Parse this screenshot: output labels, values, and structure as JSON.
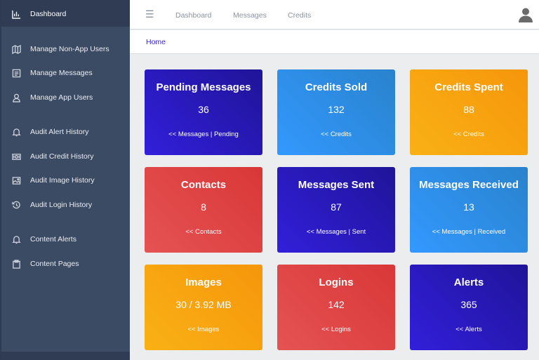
{
  "sidebar": {
    "items": [
      {
        "label": "Dashboard"
      },
      {
        "label": "Manage Non-App Users"
      },
      {
        "label": "Manage Messages"
      },
      {
        "label": "Manage App Users"
      },
      {
        "label": "Audit Alert History"
      },
      {
        "label": "Audit Credit History"
      },
      {
        "label": "Audit Image History"
      },
      {
        "label": "Audit Login History"
      },
      {
        "label": "Content Alerts"
      },
      {
        "label": "Content Pages"
      }
    ]
  },
  "header": {
    "menu_icon": "☰",
    "nav": [
      {
        "label": "Dashboard"
      },
      {
        "label": "Messages"
      },
      {
        "label": "Credits"
      }
    ]
  },
  "breadcrumb": {
    "home": "Home"
  },
  "cards": [
    {
      "title": "Pending Messages",
      "value": "36",
      "link": "<< Messages | Pending",
      "color": "#321fdb"
    },
    {
      "title": "Credits Sold",
      "value": "132",
      "link": "<< Credits",
      "color": "#3399ff"
    },
    {
      "title": "Credits Spent",
      "value": "88",
      "link": "<< Credits",
      "color": "#f9b115"
    },
    {
      "title": "Contacts",
      "value": "8",
      "link": "<< Contacts",
      "color": "#e55353"
    },
    {
      "title": "Messages Sent",
      "value": "87",
      "link": "<< Messages | Sent",
      "color": "#321fdb"
    },
    {
      "title": "Messages Received",
      "value": "13",
      "link": "<< Messages | Received",
      "color": "#3399ff"
    },
    {
      "title": "Images",
      "value": "30 / 3.92 MB",
      "link": "<< Images",
      "color": "#f9b115"
    },
    {
      "title": "Logins",
      "value": "142",
      "link": "<< Logins",
      "color": "#e55353"
    },
    {
      "title": "Alerts",
      "value": "365",
      "link": "<< Alerts",
      "color": "#321fdb"
    }
  ]
}
